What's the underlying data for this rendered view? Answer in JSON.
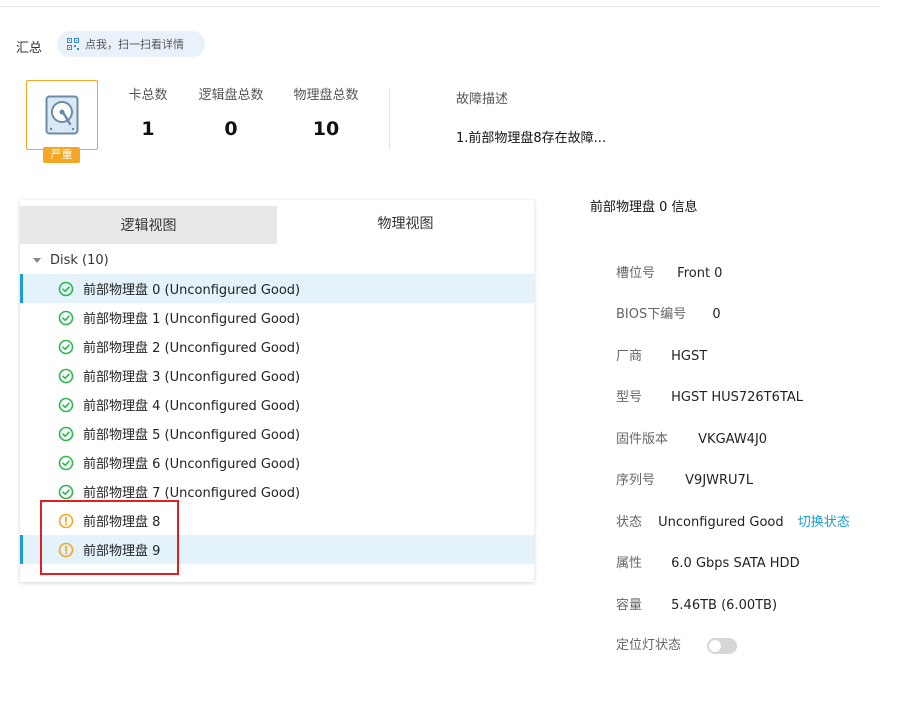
{
  "summary": {
    "title": "汇总",
    "scan_label": "点我，扫一扫看详情",
    "severity": "严重",
    "stats": [
      {
        "label": "卡总数",
        "value": "1"
      },
      {
        "label": "逻辑盘总数",
        "value": "0"
      },
      {
        "label": "物理盘总数",
        "value": "10"
      }
    ],
    "fault_title": "故障描述",
    "fault_desc": "1.前部物理盘8存在故障..."
  },
  "tabs": {
    "logical": "逻辑视图",
    "physical": "物理视图",
    "active": "physical"
  },
  "tree": {
    "root_label": "Disk (10)",
    "disks": [
      {
        "label": "前部物理盘 0 (Unconfigured Good)",
        "status": "ok",
        "selected": true
      },
      {
        "label": "前部物理盘 1 (Unconfigured Good)",
        "status": "ok",
        "selected": false
      },
      {
        "label": "前部物理盘 2 (Unconfigured Good)",
        "status": "ok",
        "selected": false
      },
      {
        "label": "前部物理盘 3 (Unconfigured Good)",
        "status": "ok",
        "selected": false
      },
      {
        "label": "前部物理盘 4 (Unconfigured Good)",
        "status": "ok",
        "selected": false
      },
      {
        "label": "前部物理盘 5 (Unconfigured Good)",
        "status": "ok",
        "selected": false
      },
      {
        "label": "前部物理盘 6 (Unconfigured Good)",
        "status": "ok",
        "selected": false
      },
      {
        "label": "前部物理盘 7 (Unconfigured Good)",
        "status": "ok",
        "selected": false
      },
      {
        "label": "前部物理盘 8",
        "status": "warning",
        "selected": false
      },
      {
        "label": "前部物理盘 9",
        "status": "warning",
        "selected": true
      }
    ]
  },
  "info": {
    "title": "前部物理盘 0 信息",
    "slot": {
      "label": "槽位号",
      "value": "Front 0"
    },
    "bios_id": {
      "label": "BIOS下编号",
      "value": "0"
    },
    "vendor": {
      "label": "厂商",
      "value": "HGST"
    },
    "model": {
      "label": "型号",
      "value": "HGST HUS726T6TAL"
    },
    "firmware": {
      "label": "固件版本",
      "value": "VKGAW4J0"
    },
    "serial": {
      "label": "序列号",
      "value": "V9JWRU7L"
    },
    "state": {
      "label": "状态",
      "value": "Unconfigured Good",
      "link": "切换状态"
    },
    "attribute": {
      "label": "属性",
      "value": "6.0 Gbps SATA HDD"
    },
    "capacity": {
      "label": "容量",
      "value": "5.46TB (6.00TB)"
    },
    "locate_led": {
      "label": "定位灯状态",
      "on": false
    }
  },
  "colors": {
    "accent": "#1a9ed8",
    "warning": "#f5a623",
    "ok": "#2db84d",
    "highlight_box": "#e02020"
  }
}
